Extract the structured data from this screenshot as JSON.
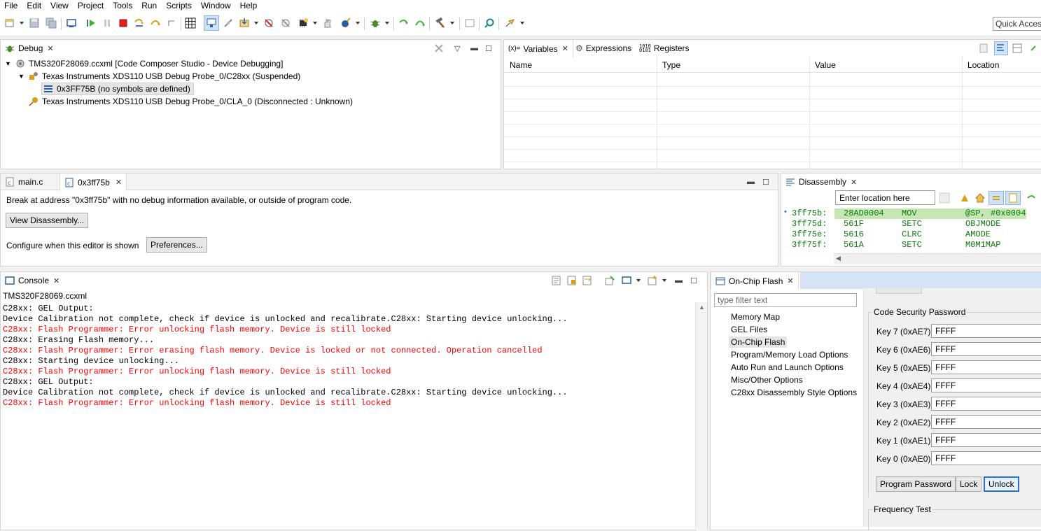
{
  "menu": [
    "File",
    "Edit",
    "View",
    "Project",
    "Tools",
    "Run",
    "Scripts",
    "Window",
    "Help"
  ],
  "quick_access": {
    "placeholder": "Quick Access"
  },
  "debug_view": {
    "tab_label": "Debug",
    "tree": [
      {
        "label": "TMS320F28069.ccxml [Code Composer Studio - Device Debugging]"
      },
      {
        "label": "Texas Instruments XDS110 USB Debug Probe_0/C28xx (Suspended)"
      },
      {
        "label": "0x3FF75B  (no symbols are defined)"
      },
      {
        "label": "Texas Instruments XDS110 USB Debug Probe_0/CLA_0 (Disconnected : Unknown)"
      }
    ]
  },
  "variables_view": {
    "tabs": [
      "Variables",
      "Expressions",
      "Registers"
    ],
    "columns": [
      "Name",
      "Type",
      "Value",
      "Location"
    ]
  },
  "editor": {
    "tabs": [
      "main.c",
      "0x3ff75b"
    ],
    "message": "Break at address \"0x3ff75b\" with no debug information available, or outside of program code.",
    "view_disassembly_label": "View Disassembly...",
    "configure_label": "Configure when this editor is shown",
    "preferences_label": "Preferences..."
  },
  "disassembly": {
    "tab_label": "Disassembly",
    "location_placeholder": "Enter location here",
    "rows": [
      {
        "addr": "3ff75b:",
        "op": "28AD0004",
        "mnem": "MOV",
        "args": "@SP, #0x0004"
      },
      {
        "addr": "3ff75d:",
        "op": "561F",
        "mnem": "SETC",
        "args": "OBJMODE"
      },
      {
        "addr": "3ff75e:",
        "op": "5616",
        "mnem": "CLRC",
        "args": "AMODE"
      },
      {
        "addr": "3ff75f:",
        "op": "561A",
        "mnem": "SETC",
        "args": "M0M1MAP"
      }
    ]
  },
  "console": {
    "tab_label": "Console",
    "title": "TMS320F28069.ccxml",
    "lines": [
      {
        "text": "C28xx: GEL Output:",
        "error": false
      },
      {
        "text": "Device Calibration not complete, check if device is unlocked and recalibrate.C28xx: Starting device unlocking...",
        "error": false
      },
      {
        "text": "C28xx: Flash Programmer: Error unlocking flash memory. Device is still locked",
        "error": true
      },
      {
        "text": "C28xx: Erasing Flash memory...",
        "error": false
      },
      {
        "text": "C28xx: Flash Programmer: Error erasing flash memory. Device is locked or not connected. Operation cancelled",
        "error": true
      },
      {
        "text": "C28xx: Starting device unlocking...",
        "error": false
      },
      {
        "text": "C28xx: Flash Programmer: Error unlocking flash memory. Device is still locked",
        "error": true
      },
      {
        "text": "C28xx: GEL Output:",
        "error": false
      },
      {
        "text": "Device Calibration not complete, check if device is unlocked and recalibrate.C28xx: Starting device unlocking...",
        "error": false
      },
      {
        "text": "C28xx: Flash Programmer: Error unlocking flash memory. Device is still locked",
        "error": true
      }
    ]
  },
  "flash_view": {
    "tab_label": "On-Chip Flash",
    "filter_placeholder": "type filter text",
    "nav_items": [
      "Memory Map",
      "GEL Files",
      "On-Chip Flash",
      "Program/Memory Load Options",
      "Auto Run and Launch Options",
      "Misc/Other Options",
      "C28xx Disassembly Style Options"
    ],
    "selected_nav": "On-Chip Flash",
    "csp_title": "Code Security Password",
    "keys": [
      {
        "label": "Key 7 (0xAE7):",
        "value": "FFFF"
      },
      {
        "label": "Key 6 (0xAE6):",
        "value": "FFFF"
      },
      {
        "label": "Key 5 (0xAE5):",
        "value": "FFFF"
      },
      {
        "label": "Key 4 (0xAE4):",
        "value": "FFFF"
      },
      {
        "label": "Key 3 (0xAE3):",
        "value": "FFFF"
      },
      {
        "label": "Key 2 (0xAE2):",
        "value": "FFFF"
      },
      {
        "label": "Key 1 (0xAE1):",
        "value": "FFFF"
      },
      {
        "label": "Key 0 (0xAE0):",
        "value": "FFFF"
      }
    ],
    "buttons": {
      "program_password": "Program Password",
      "lock": "Lock",
      "unlock": "Unlock"
    },
    "freq_title": "Frequency Test"
  },
  "colors": {
    "error_text": "#ff0000",
    "disasm_highlight": "#c6e6b4",
    "disasm_text": "#0a7a0a",
    "selection": "#e5e5e5"
  }
}
